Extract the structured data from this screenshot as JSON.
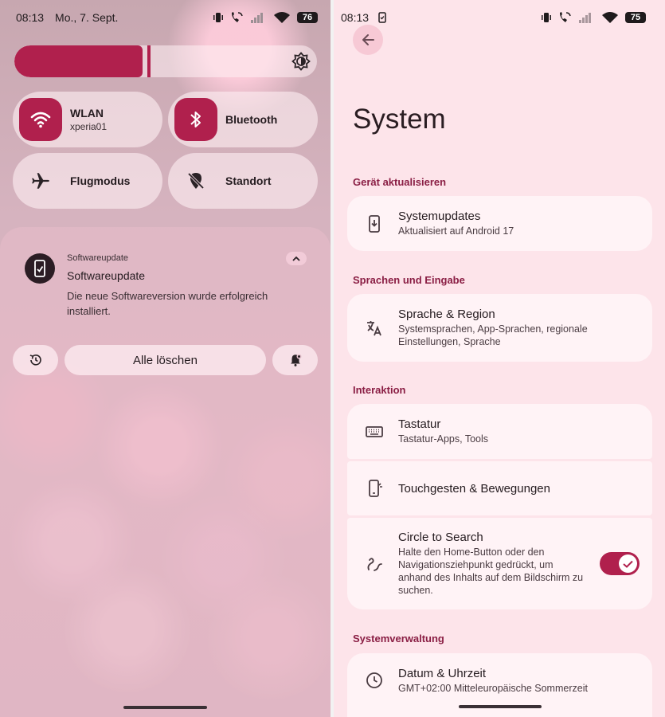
{
  "left": {
    "status": {
      "time": "08:13",
      "date": "Mo., 7. Sept.",
      "battery": "76"
    },
    "brightness": {
      "level": 0.44
    },
    "tiles": [
      {
        "id": "wlan",
        "label": "WLAN",
        "sublabel": "xperia01",
        "active": true,
        "icon": "wifi-icon"
      },
      {
        "id": "bluetooth",
        "label": "Bluetooth",
        "active": true,
        "icon": "bluetooth-icon"
      },
      {
        "id": "airplane",
        "label": "Flugmodus",
        "active": false,
        "icon": "airplane-icon"
      },
      {
        "id": "location",
        "label": "Standort",
        "active": false,
        "icon": "location-off-icon"
      }
    ],
    "notification": {
      "app": "Softwareupdate",
      "title": "Softwareupdate",
      "body": "Die neue Softwareversion wurde erfolgreich installiert."
    },
    "actions": {
      "clear_all": "Alle löschen"
    }
  },
  "right": {
    "status": {
      "time": "08:13",
      "battery": "75"
    },
    "title": "System",
    "sections": {
      "update": "Gerät aktualisieren",
      "language": "Sprachen und Eingabe",
      "interaction": "Interaktion",
      "system": "Systemverwaltung"
    },
    "items": {
      "systemupdates": {
        "title": "Systemupdates",
        "subtitle": "Aktualisiert auf Android 17"
      },
      "language": {
        "title": "Sprache & Region",
        "subtitle": "Systemsprachen, App-Sprachen, regionale Einstellungen, Sprache"
      },
      "keyboard": {
        "title": "Tastatur",
        "subtitle": "Tastatur-Apps, Tools"
      },
      "gestures": {
        "title": "Touchgesten & Bewegungen"
      },
      "circle": {
        "title": "Circle to Search",
        "subtitle": "Halte den Home-Button oder den Navigationsziehpunkt gedrückt, um anhand des Inhalts auf dem Bildschirm zu suchen.",
        "enabled": true
      },
      "datetime": {
        "title": "Datum & Uhrzeit",
        "subtitle": "GMT+02:00 Mitteleuropäische Sommerzeit"
      }
    }
  },
  "colors": {
    "accent": "#b0204d",
    "section_text": "#8a1e44",
    "settings_bg": "#fde4ea",
    "card_bg": "#fff3f6"
  }
}
